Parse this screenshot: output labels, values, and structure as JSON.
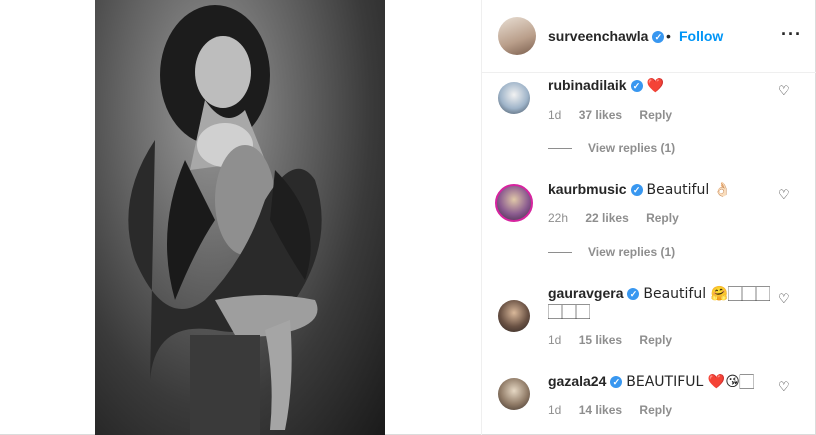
{
  "post": {
    "author": "surveenchawla",
    "follow_label": "Follow",
    "separator": "•",
    "more_label": "···"
  },
  "icons": {
    "verified": "verified-badge-icon",
    "heart": "heart-outline-icon",
    "more": "more-options-icon"
  },
  "colors": {
    "follow": "#0095f6",
    "verified": "#3897f0",
    "meta": "#8e8e8e"
  },
  "comments": [
    {
      "user": "rubinadilaik",
      "text": "❤️",
      "time": "1d",
      "likes": "37 likes",
      "reply": "Reply",
      "view_replies": "View replies (1)"
    },
    {
      "user": "kaurbmusic",
      "text": "Beautiful 👌🏻",
      "time": "22h",
      "likes": "22 likes",
      "reply": "Reply",
      "view_replies": "View replies (1)"
    },
    {
      "user": "gauravgera",
      "text": "Beautiful 🤗🏻🏻🏻",
      "text_line2": "🏻🏻🏻",
      "time": "1d",
      "likes": "15 likes",
      "reply": "Reply"
    },
    {
      "user": "gazala24",
      "text": "BEAUTIFUL ❤️😘🏻",
      "time": "1d",
      "likes": "14 likes",
      "reply": "Reply"
    }
  ]
}
